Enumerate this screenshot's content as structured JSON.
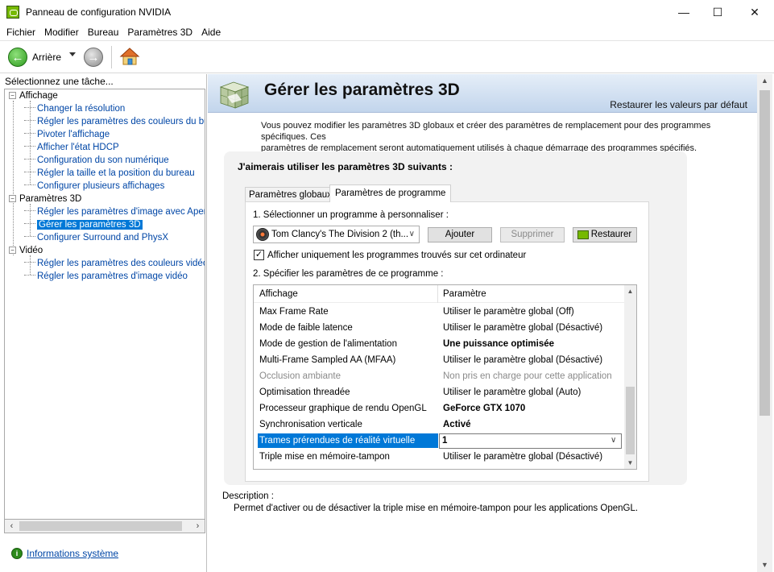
{
  "window": {
    "title": "Panneau de configuration NVIDIA",
    "minimize": "—",
    "maximize": "☐",
    "close": "✕"
  },
  "menu": [
    "Fichier",
    "Modifier",
    "Bureau",
    "Paramètres 3D",
    "Aide"
  ],
  "toolbar": {
    "back_label": "Arrière",
    "back_icon": "arrow-left-icon",
    "forward_icon": "arrow-right-icon",
    "home_icon": "home-icon"
  },
  "sidebar": {
    "header": "Sélectionnez une tâche...",
    "categories": [
      {
        "label": "Affichage",
        "items": [
          "Changer la résolution",
          "Régler les paramètres des couleurs du bure",
          "Pivoter l'affichage",
          "Afficher l'état HDCP",
          "Configuration du son numérique",
          "Régler la taille et la position du bureau",
          "Configurer plusieurs affichages"
        ]
      },
      {
        "label": "Paramètres 3D",
        "items": [
          "Régler les paramètres d'image avec Aperçu",
          "Gérer les paramètres 3D",
          "Configurer Surround and PhysX"
        ]
      },
      {
        "label": "Vidéo",
        "items": [
          "Régler les paramètres des couleurs vidéo",
          "Régler les paramètres d'image vidéo"
        ]
      }
    ],
    "selected_item": "Gérer les paramètres 3D",
    "system_info": "Informations système"
  },
  "main": {
    "title": "Gérer les paramètres 3D",
    "restore_defaults": "Restaurer les valeurs par défaut",
    "intro_line1": "Vous pouvez modifier les paramètres 3D globaux et créer des paramètres de remplacement pour des programmes spécifiques. Ces",
    "intro_line2": "paramètres de remplacement seront automatiquement utilisés à chaque démarrage des programmes spécifiés.",
    "settings_heading": "J'aimerais utiliser les paramètres 3D suivants :",
    "tabs": [
      {
        "label": "Paramètres globaux",
        "active": false
      },
      {
        "label": "Paramètres de programme",
        "active": true
      }
    ],
    "step1_label": "1. Sélectionner un programme à personnaliser :",
    "program_selected": "Tom Clancy's The Division 2 (th...",
    "add_button": "Ajouter",
    "remove_button": "Supprimer",
    "restore_button": "Restaurer",
    "show_only_label": "Afficher uniquement les programmes trouvés sur cet ordinateur",
    "show_only_checked": "✓",
    "step2_label": "2. Spécifier les paramètres de ce programme :",
    "table": {
      "col_feature": "Affichage",
      "col_setting": "Paramètre",
      "rows": [
        {
          "feature": "Max Frame Rate",
          "value": "Utiliser le paramètre global (Off)",
          "style": "normal"
        },
        {
          "feature": "Mode de faible latence",
          "value": "Utiliser le paramètre global (Désactivé)",
          "style": "normal"
        },
        {
          "feature": "Mode de gestion de l'alimentation",
          "value": "Une puissance optimisée",
          "style": "bold"
        },
        {
          "feature": "Multi-Frame Sampled AA (MFAA)",
          "value": "Utiliser le paramètre global (Désactivé)",
          "style": "normal"
        },
        {
          "feature": "Occlusion ambiante",
          "value": "Non pris en charge pour cette application",
          "style": "disabled"
        },
        {
          "feature": "Optimisation threadée",
          "value": "Utiliser le paramètre global (Auto)",
          "style": "normal"
        },
        {
          "feature": "Processeur graphique de rendu OpenGL",
          "value": "GeForce GTX 1070",
          "style": "bold"
        },
        {
          "feature": "Synchronisation verticale",
          "value": "Activé",
          "style": "bold"
        },
        {
          "feature": "Trames prérendues de réalité virtuelle",
          "value": "1",
          "style": "selected"
        },
        {
          "feature": "Triple mise en mémoire-tampon",
          "value": "Utiliser le paramètre global (Désactivé)",
          "style": "normal"
        }
      ]
    },
    "description_label": "Description :",
    "description_text": "Permet d'activer ou de désactiver la triple mise en mémoire-tampon pour les applications OpenGL."
  },
  "colors": {
    "accent": "#0078d7",
    "nvidia_green": "#76b900",
    "link": "#0046a6"
  }
}
